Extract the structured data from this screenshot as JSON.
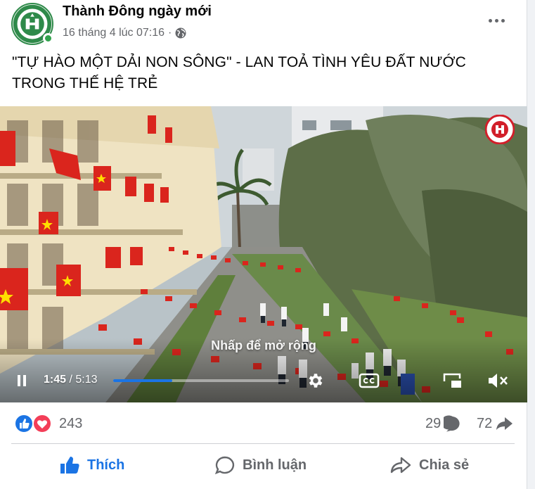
{
  "post": {
    "page_name": "Thành Đông ngày mới",
    "timestamp": "16 tháng 4 lúc 07:16",
    "privacy_icon": "globe-icon",
    "text": "\"TỰ HÀO MỘT DẢI NON SÔNG\" - LAN TOẢ TÌNH YÊU ĐẤT NƯỚC TRONG THẾ HỆ TRẺ"
  },
  "video": {
    "overlay_text": "Nhấp để mở rộng",
    "current_time": "1:45",
    "separator": " / ",
    "total_time": "5:13",
    "progress": 0.335
  },
  "stats": {
    "reactions_count": "243",
    "comments_count": "29",
    "shares_count": "72"
  },
  "actions": {
    "like": "Thích",
    "comment": "Bình luận",
    "share": "Chia sẻ"
  },
  "colors": {
    "accent": "#1b74e4",
    "flag_red": "#da251d",
    "flag_star": "#ffde00",
    "love": "#f33e58"
  }
}
